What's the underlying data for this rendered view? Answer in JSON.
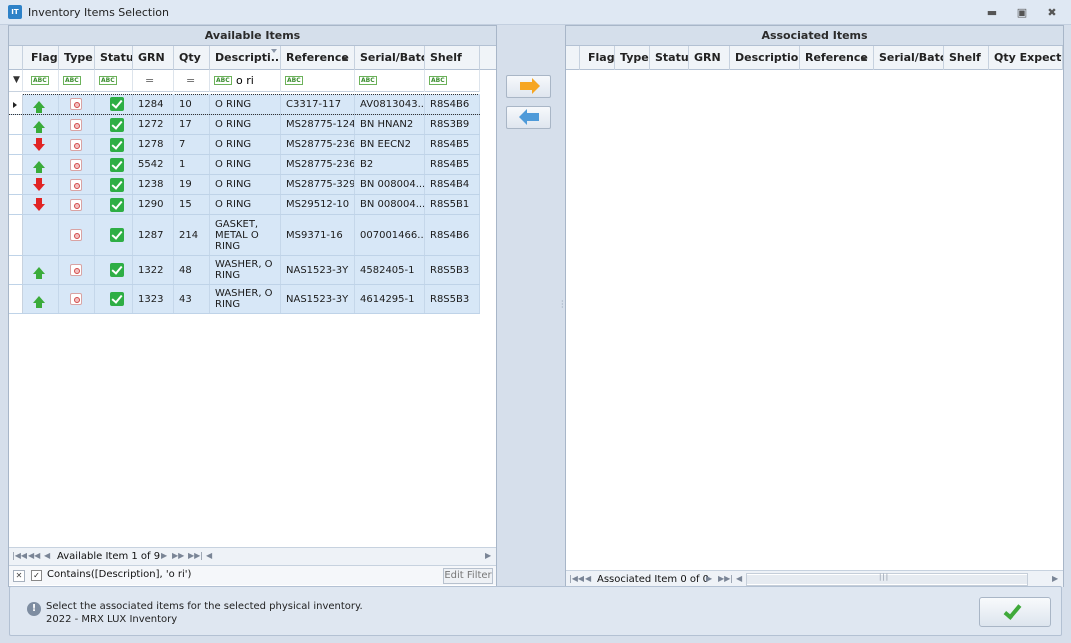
{
  "window": {
    "title": "Inventory Items Selection",
    "icon_text": "IT",
    "controls": [
      "minimize-icon",
      "maximize-icon",
      "close-icon"
    ]
  },
  "available": {
    "band_title": "Available Items",
    "columns": [
      "Flag",
      "Type",
      "Status",
      "GRN",
      "Qty",
      "Descripti...",
      "Reference",
      "Serial/Batch",
      "Shelf"
    ],
    "filter": {
      "description_text": "o ri"
    },
    "rows": [
      {
        "flag": "up",
        "type": "item",
        "status": "ok",
        "grn": "1284",
        "qty": "10",
        "description": "O RING",
        "reference": "C3317-117",
        "serial": "AV0813043...",
        "shelf": "R8S4B6"
      },
      {
        "flag": "up",
        "type": "item",
        "status": "ok",
        "grn": "1272",
        "qty": "17",
        "description": "O RING",
        "reference": "MS28775-124",
        "serial": "BN HNAN2",
        "shelf": "R8S3B9"
      },
      {
        "flag": "down",
        "type": "item",
        "status": "ok",
        "grn": "1278",
        "qty": "7",
        "description": "O RING",
        "reference": "MS28775-236",
        "serial": "BN EECN2",
        "shelf": "R8S4B5"
      },
      {
        "flag": "up",
        "type": "item",
        "status": "ok",
        "grn": "5542",
        "qty": "1",
        "description": "O RING",
        "reference": "MS28775-236",
        "serial": "B2",
        "shelf": "R8S4B5"
      },
      {
        "flag": "down",
        "type": "item",
        "status": "ok",
        "grn": "1238",
        "qty": "19",
        "description": "O RING",
        "reference": "MS28775-329",
        "serial": "BN 008004...",
        "shelf": "R8S4B4"
      },
      {
        "flag": "down",
        "type": "item",
        "status": "ok",
        "grn": "1290",
        "qty": "15",
        "description": "O RING",
        "reference": "MS29512-10",
        "serial": "BN 008004...",
        "shelf": "R8S5B1"
      },
      {
        "flag": "",
        "type": "item",
        "status": "ok",
        "grn": "1287",
        "qty": "214",
        "description": "GASKET, METAL O RING",
        "reference": "MS9371-16",
        "serial": "007001466...",
        "shelf": "R8S4B6"
      },
      {
        "flag": "up",
        "type": "item",
        "status": "ok",
        "grn": "1322",
        "qty": "48",
        "description": "WASHER, O RING",
        "reference": "NAS1523-3Y",
        "serial": "4582405-1",
        "shelf": "R8S5B3"
      },
      {
        "flag": "up",
        "type": "item",
        "status": "ok",
        "grn": "1323",
        "qty": "43",
        "description": "WASHER, O RING",
        "reference": "NAS1523-3Y",
        "serial": "4614295-1",
        "shelf": "R8S5B3"
      }
    ],
    "nav_label": "Available Item 1 of 9",
    "filter_expression": "Contains([Description], 'o ri')",
    "edit_filter_label": "Edit Filter"
  },
  "associated": {
    "band_title": "Associated Items",
    "columns": [
      "Flag",
      "Type",
      "Status",
      "GRN",
      "Description",
      "Reference",
      "Serial/Batch",
      "Shelf",
      "Qty Expected"
    ],
    "nav_label": "Associated Item 0 of 0"
  },
  "status": {
    "line1": "Select the associated items for the selected physical inventory.",
    "line2": "2022 - MRX LUX Inventory"
  }
}
